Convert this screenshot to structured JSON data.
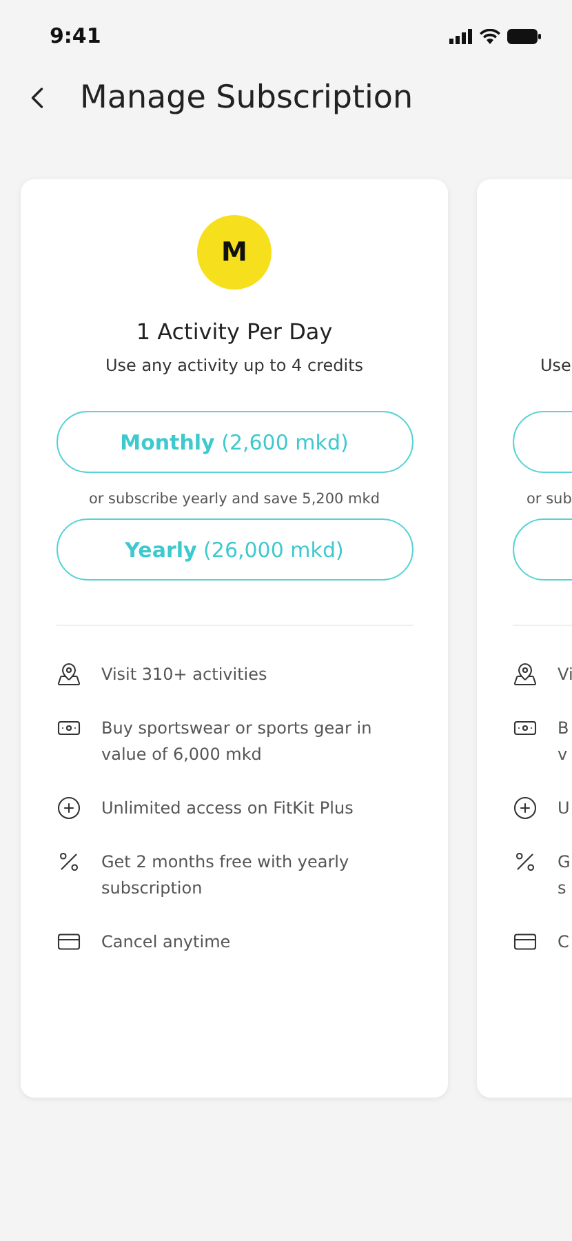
{
  "status_bar": {
    "time": "9:41"
  },
  "header": {
    "title": "Manage Subscription"
  },
  "plans": [
    {
      "cut": false,
      "badge": "M",
      "title": "1 Activity Per Day",
      "subtitle": "Use any activity up to 4 credits",
      "monthly": "**Monthly** (2,600 mkd)",
      "note": "or subscribe yearly and save 5,200 mkd",
      "yearly": "**Yearly** (26,000 mkd)",
      "features": [
        {
          "kind": "map",
          "lines": [
            "Visit 310+ activities"
          ]
        },
        {
          "kind": "cash",
          "lines": [
            "Buy sportswear or sports gear in",
            "value of 6,000 mkd"
          ]
        },
        {
          "kind": "plus",
          "lines": [
            "Unlimited access on FitKit Plus"
          ]
        },
        {
          "kind": "percent",
          "lines": [
            "Get 2 months free with yearly",
            "subscription"
          ]
        },
        {
          "kind": "card",
          "lines": [
            "Cancel anytime"
          ]
        }
      ]
    },
    {
      "cut": true,
      "subtitle": "Use",
      "note": "or sub",
      "features": [
        {
          "kind": "map",
          "lines": [
            "Vi"
          ]
        },
        {
          "kind": "cash",
          "lines": [
            "B",
            "v"
          ]
        },
        {
          "kind": "plus",
          "lines": [
            "U"
          ]
        },
        {
          "kind": "percent",
          "lines": [
            "G",
            "s"
          ]
        },
        {
          "kind": "card",
          "lines": [
            "C"
          ]
        }
      ]
    }
  ]
}
